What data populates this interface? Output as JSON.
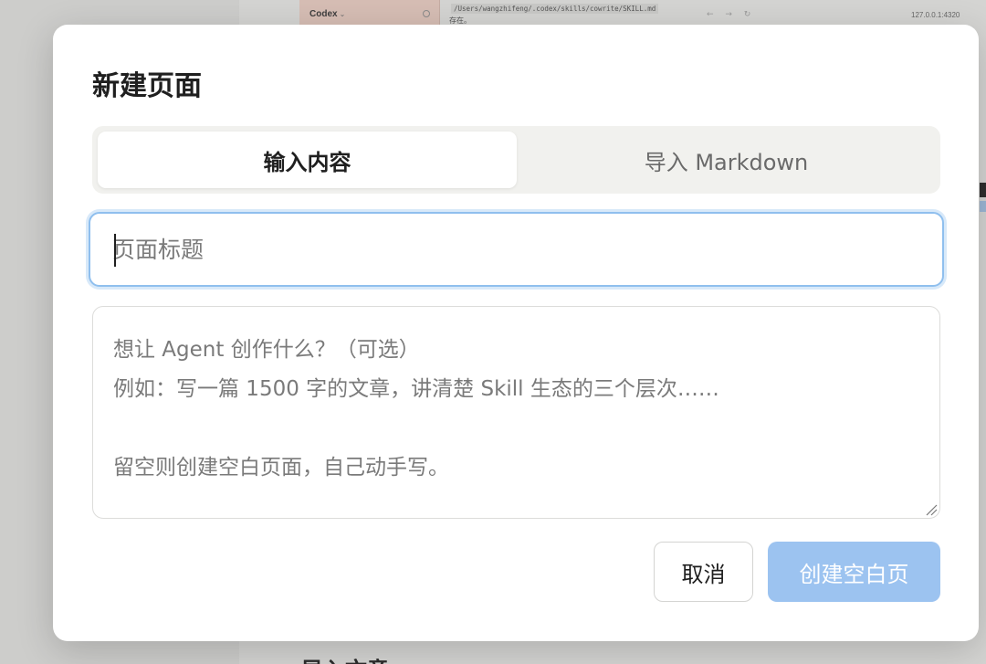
{
  "background": {
    "sidebar_title": "Codex",
    "path_text": "/Users/wangzhifeng/.codex/skills/cowrite/SKILL.md",
    "path_subtext": "存在。",
    "nav_arrows": "← → ↻",
    "url": "127.0.0.1:4320",
    "footer_text": "导入文章"
  },
  "dialog": {
    "title": "新建页面",
    "tabs": [
      {
        "label": "输入内容",
        "active": true
      },
      {
        "label": "导入 Markdown",
        "active": false
      }
    ],
    "title_input": {
      "placeholder": "页面标题",
      "value": ""
    },
    "prompt_input": {
      "placeholder": "想让 Agent 创作什么？（可选）\n例如：写一篇 1500 字的文章，讲清楚 Skill 生态的三个层次……\n\n留空则创建空白页面，自己动手写。",
      "value": ""
    },
    "cancel_label": "取消",
    "create_label": "创建空白页"
  },
  "colors": {
    "accent_focus": "#8fbfee",
    "create_button_disabled": "#9cc3f0",
    "tab_track": "#f1f1ee"
  }
}
